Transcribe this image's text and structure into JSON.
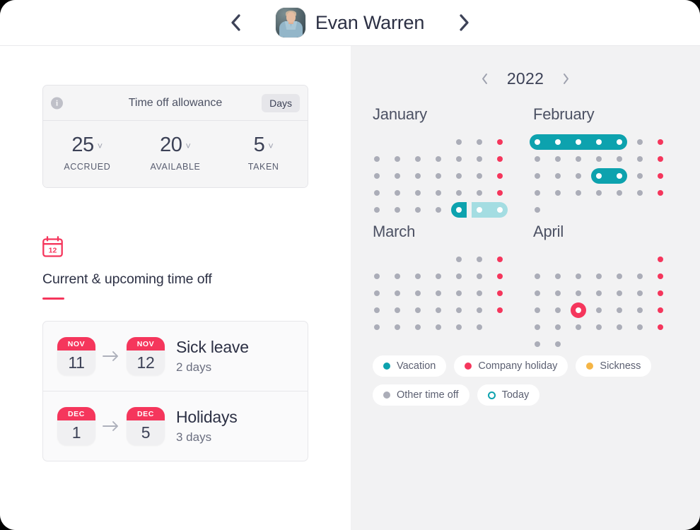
{
  "header": {
    "prev_icon": "chevron-left-icon",
    "next_icon": "chevron-right-icon",
    "person_name": "Evan Warren",
    "avatar_alt": "Evan Warren"
  },
  "allowance": {
    "info_icon": "info-icon",
    "title": "Time off allowance",
    "unit_badge": "Days",
    "stats": [
      {
        "value": "25",
        "label": "ACCRUED"
      },
      {
        "value": "20",
        "label": "AVAILABLE"
      },
      {
        "value": "5",
        "label": "TAKEN"
      }
    ]
  },
  "upcoming": {
    "icon": "calendar-icon",
    "icon_day": "12",
    "title": "Current & upcoming time off",
    "entries": [
      {
        "start_month": "NOV",
        "start_day": "11",
        "end_month": "NOV",
        "end_day": "12",
        "name": "Sick leave",
        "duration": "2 days"
      },
      {
        "start_month": "DEC",
        "start_day": "1",
        "end_month": "DEC",
        "end_day": "5",
        "name": "Holidays",
        "duration": "3 days"
      }
    ]
  },
  "calendar": {
    "prev_icon": "chevron-left-icon",
    "next_icon": "chevron-right-icon",
    "year": "2022",
    "columns": 7,
    "rows": 5,
    "months": [
      {
        "name": "January",
        "dots": [
          {
            "r": 1,
            "c": 5,
            "type": "grey"
          },
          {
            "r": 1,
            "c": 6,
            "type": "grey"
          },
          {
            "r": 1,
            "c": 7,
            "type": "red"
          },
          {
            "r": 2,
            "c": 1,
            "type": "grey"
          },
          {
            "r": 2,
            "c": 2,
            "type": "grey"
          },
          {
            "r": 2,
            "c": 3,
            "type": "grey"
          },
          {
            "r": 2,
            "c": 4,
            "type": "grey"
          },
          {
            "r": 2,
            "c": 5,
            "type": "grey"
          },
          {
            "r": 2,
            "c": 6,
            "type": "grey"
          },
          {
            "r": 2,
            "c": 7,
            "type": "red"
          },
          {
            "r": 3,
            "c": 1,
            "type": "grey"
          },
          {
            "r": 3,
            "c": 2,
            "type": "grey"
          },
          {
            "r": 3,
            "c": 3,
            "type": "grey"
          },
          {
            "r": 3,
            "c": 4,
            "type": "grey"
          },
          {
            "r": 3,
            "c": 5,
            "type": "grey"
          },
          {
            "r": 3,
            "c": 6,
            "type": "grey"
          },
          {
            "r": 3,
            "c": 7,
            "type": "red"
          },
          {
            "r": 4,
            "c": 1,
            "type": "grey"
          },
          {
            "r": 4,
            "c": 2,
            "type": "grey"
          },
          {
            "r": 4,
            "c": 3,
            "type": "grey"
          },
          {
            "r": 4,
            "c": 4,
            "type": "grey"
          },
          {
            "r": 4,
            "c": 5,
            "type": "grey"
          },
          {
            "r": 4,
            "c": 6,
            "type": "grey"
          },
          {
            "r": 4,
            "c": 7,
            "type": "red"
          },
          {
            "r": 5,
            "c": 1,
            "type": "grey"
          },
          {
            "r": 5,
            "c": 2,
            "type": "grey"
          },
          {
            "r": 5,
            "c": 3,
            "type": "grey"
          },
          {
            "r": 5,
            "c": 4,
            "type": "grey"
          }
        ],
        "pills": [
          {
            "r": 5,
            "c1": 5,
            "c2": 5,
            "type": "teal",
            "round": "left"
          },
          {
            "r": 5,
            "c1": 6,
            "c2": 7,
            "type": "lteal",
            "round": "right"
          }
        ]
      },
      {
        "name": "February",
        "dots": [
          {
            "r": 1,
            "c": 6,
            "type": "grey"
          },
          {
            "r": 1,
            "c": 7,
            "type": "red"
          },
          {
            "r": 2,
            "c": 1,
            "type": "grey"
          },
          {
            "r": 2,
            "c": 2,
            "type": "grey"
          },
          {
            "r": 2,
            "c": 3,
            "type": "grey"
          },
          {
            "r": 2,
            "c": 4,
            "type": "grey"
          },
          {
            "r": 2,
            "c": 5,
            "type": "grey"
          },
          {
            "r": 2,
            "c": 6,
            "type": "grey"
          },
          {
            "r": 2,
            "c": 7,
            "type": "red"
          },
          {
            "r": 3,
            "c": 1,
            "type": "grey"
          },
          {
            "r": 3,
            "c": 2,
            "type": "grey"
          },
          {
            "r": 3,
            "c": 3,
            "type": "grey"
          },
          {
            "r": 3,
            "c": 6,
            "type": "grey"
          },
          {
            "r": 3,
            "c": 7,
            "type": "red"
          },
          {
            "r": 4,
            "c": 1,
            "type": "grey"
          },
          {
            "r": 4,
            "c": 2,
            "type": "grey"
          },
          {
            "r": 4,
            "c": 3,
            "type": "grey"
          },
          {
            "r": 4,
            "c": 4,
            "type": "grey"
          },
          {
            "r": 4,
            "c": 5,
            "type": "grey"
          },
          {
            "r": 4,
            "c": 6,
            "type": "grey"
          },
          {
            "r": 4,
            "c": 7,
            "type": "red"
          },
          {
            "r": 5,
            "c": 1,
            "type": "grey"
          }
        ],
        "pills": [
          {
            "r": 1,
            "c1": 1,
            "c2": 5,
            "type": "teal",
            "round": "both"
          },
          {
            "r": 3,
            "c1": 4,
            "c2": 5,
            "type": "teal",
            "round": "both"
          }
        ]
      },
      {
        "name": "March",
        "dots": [
          {
            "r": 1,
            "c": 5,
            "type": "grey"
          },
          {
            "r": 1,
            "c": 6,
            "type": "grey"
          },
          {
            "r": 1,
            "c": 7,
            "type": "red"
          },
          {
            "r": 2,
            "c": 1,
            "type": "grey"
          },
          {
            "r": 2,
            "c": 2,
            "type": "grey"
          },
          {
            "r": 2,
            "c": 3,
            "type": "grey"
          },
          {
            "r": 2,
            "c": 4,
            "type": "grey"
          },
          {
            "r": 2,
            "c": 5,
            "type": "grey"
          },
          {
            "r": 2,
            "c": 6,
            "type": "grey"
          },
          {
            "r": 2,
            "c": 7,
            "type": "red"
          },
          {
            "r": 3,
            "c": 1,
            "type": "grey"
          },
          {
            "r": 3,
            "c": 2,
            "type": "grey"
          },
          {
            "r": 3,
            "c": 3,
            "type": "grey"
          },
          {
            "r": 3,
            "c": 4,
            "type": "grey"
          },
          {
            "r": 3,
            "c": 5,
            "type": "grey"
          },
          {
            "r": 3,
            "c": 6,
            "type": "grey"
          },
          {
            "r": 3,
            "c": 7,
            "type": "red"
          },
          {
            "r": 4,
            "c": 1,
            "type": "grey"
          },
          {
            "r": 4,
            "c": 2,
            "type": "grey"
          },
          {
            "r": 4,
            "c": 3,
            "type": "grey"
          },
          {
            "r": 4,
            "c": 4,
            "type": "grey"
          },
          {
            "r": 4,
            "c": 5,
            "type": "grey"
          },
          {
            "r": 4,
            "c": 6,
            "type": "grey"
          },
          {
            "r": 4,
            "c": 7,
            "type": "red"
          },
          {
            "r": 5,
            "c": 1,
            "type": "grey"
          },
          {
            "r": 5,
            "c": 2,
            "type": "grey"
          },
          {
            "r": 5,
            "c": 3,
            "type": "grey"
          },
          {
            "r": 5,
            "c": 4,
            "type": "grey"
          },
          {
            "r": 5,
            "c": 5,
            "type": "grey"
          },
          {
            "r": 5,
            "c": 6,
            "type": "grey"
          }
        ],
        "pills": []
      },
      {
        "name": "April",
        "dots": [
          {
            "r": 1,
            "c": 7,
            "type": "red"
          },
          {
            "r": 2,
            "c": 1,
            "type": "grey"
          },
          {
            "r": 2,
            "c": 2,
            "type": "grey"
          },
          {
            "r": 2,
            "c": 3,
            "type": "grey"
          },
          {
            "r": 2,
            "c": 4,
            "type": "grey"
          },
          {
            "r": 2,
            "c": 5,
            "type": "grey"
          },
          {
            "r": 2,
            "c": 6,
            "type": "grey"
          },
          {
            "r": 2,
            "c": 7,
            "type": "red"
          },
          {
            "r": 3,
            "c": 1,
            "type": "grey"
          },
          {
            "r": 3,
            "c": 2,
            "type": "grey"
          },
          {
            "r": 3,
            "c": 3,
            "type": "grey"
          },
          {
            "r": 3,
            "c": 4,
            "type": "grey"
          },
          {
            "r": 3,
            "c": 5,
            "type": "grey"
          },
          {
            "r": 3,
            "c": 6,
            "type": "grey"
          },
          {
            "r": 3,
            "c": 7,
            "type": "red"
          },
          {
            "r": 4,
            "c": 1,
            "type": "grey"
          },
          {
            "r": 4,
            "c": 2,
            "type": "grey"
          },
          {
            "r": 4,
            "c": 4,
            "type": "grey"
          },
          {
            "r": 4,
            "c": 5,
            "type": "grey"
          },
          {
            "r": 4,
            "c": 6,
            "type": "grey"
          },
          {
            "r": 4,
            "c": 7,
            "type": "red"
          },
          {
            "r": 5,
            "c": 1,
            "type": "grey"
          },
          {
            "r": 5,
            "c": 2,
            "type": "grey"
          },
          {
            "r": 5,
            "c": 3,
            "type": "grey"
          },
          {
            "r": 5,
            "c": 4,
            "type": "grey"
          },
          {
            "r": 5,
            "c": 5,
            "type": "grey"
          },
          {
            "r": 5,
            "c": 6,
            "type": "grey"
          },
          {
            "r": 5,
            "c": 7,
            "type": "red"
          },
          {
            "r": 6,
            "c": 1,
            "type": "grey"
          },
          {
            "r": 6,
            "c": 2,
            "type": "grey"
          }
        ],
        "pills": [
          {
            "r": 4,
            "c1": 3,
            "c2": 3,
            "type": "red",
            "round": "both"
          }
        ]
      }
    ],
    "legend": [
      {
        "label": "Vacation",
        "color": "#0da2ae",
        "style": "solid"
      },
      {
        "label": "Company holiday",
        "color": "#f5365c",
        "style": "solid"
      },
      {
        "label": "Sickness",
        "color": "#f5b545",
        "style": "solid"
      },
      {
        "label": "Other time off",
        "color": "#abadb8",
        "style": "solid"
      },
      {
        "label": "Today",
        "color": "#0da2ae",
        "style": "ring"
      }
    ]
  },
  "colors": {
    "accent_red": "#f5365c",
    "teal": "#0da2ae",
    "light_teal": "#a4dde2",
    "amber": "#f5b545",
    "grey_dot": "#abadb8",
    "panel_bg": "#f2f2f3",
    "text_dark": "#2c3044"
  }
}
